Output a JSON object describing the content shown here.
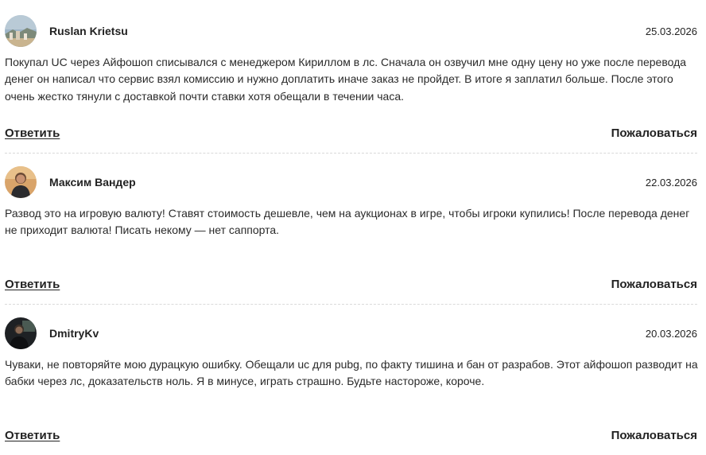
{
  "comments": [
    {
      "author": "Ruslan Krietsu",
      "date": "25.03.2026",
      "avatar_icon": "landscape-photo-avatar",
      "text": "Покупал UC через Айфошоп списывался с менеджером Кириллом в лс. Сначала он озвучил мне одну цену но уже после перевода денег он написал что сервис взял комиссию и нужно доплатить иначе заказ не пройдет. В итоге я заплатил больше. После этого очень жестко тянули с доставкой почти ставки хотя обещали в течении часа.",
      "reply_label": "Ответить",
      "report_label": "Пожаловаться"
    },
    {
      "author": "Максим Вандер",
      "date": "22.03.2026",
      "avatar_icon": "person-photo-avatar",
      "text": "Развод это на игровую валюту! Ставят стоимость дешевле, чем на аукционах в игре, чтобы игроки купились! После перевода денег не приходит валюта! Писать некому — нет саппорта.",
      "reply_label": "Ответить",
      "report_label": "Пожаловаться"
    },
    {
      "author": "DmitryKv",
      "date": "20.03.2026",
      "avatar_icon": "dark-person-photo-avatar",
      "text": "Чуваки, не повторяйте мою дурацкую ошибку. Обещали uc для pubg, по факту тишина и бан от разрабов. Этот айфошоп разводит на бабки через лс, доказательств ноль. Я в минусе, играть страшно. Будьте настороже, короче.",
      "reply_label": "Ответить",
      "report_label": "Пожаловаться"
    }
  ]
}
